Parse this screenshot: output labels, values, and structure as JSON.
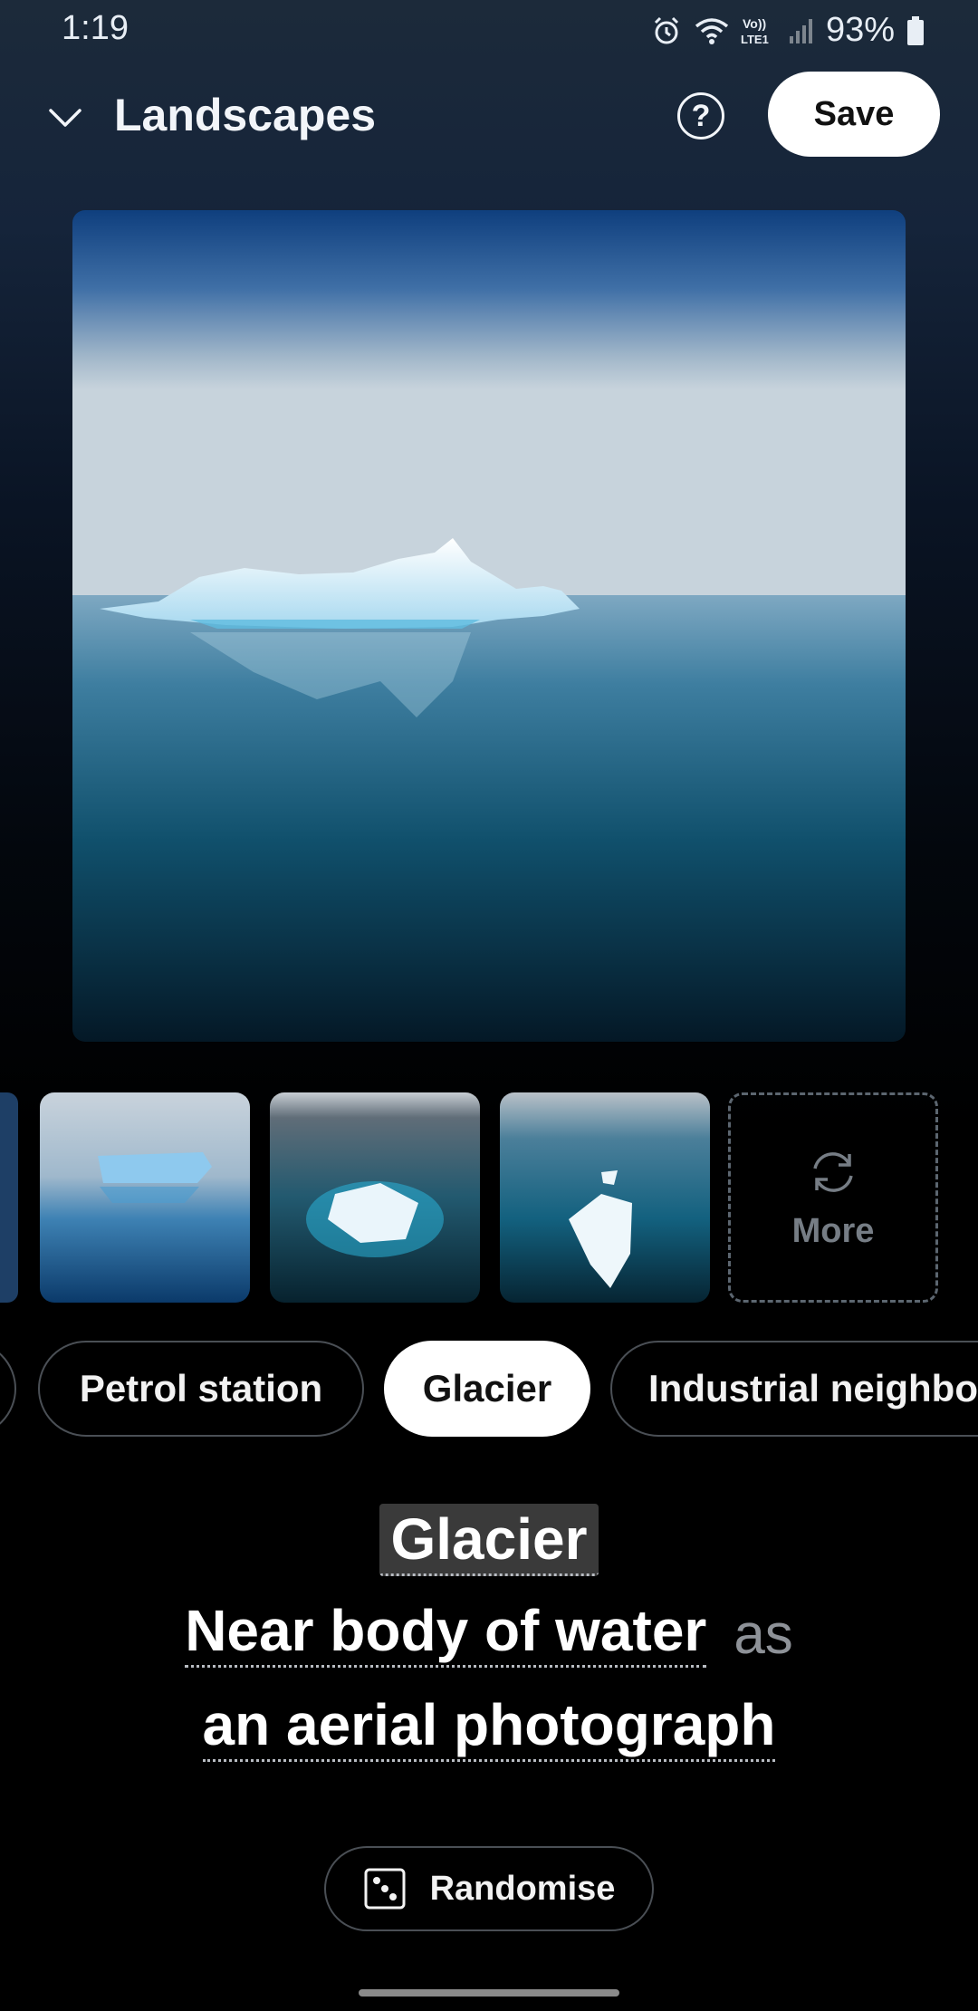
{
  "status_bar": {
    "time": "1:19",
    "battery": "93%",
    "network": "Vo)) LTE1",
    "icons": [
      "alarm-icon",
      "wifi-icon",
      "volte-icon",
      "signal-icon",
      "battery-icon"
    ]
  },
  "header": {
    "title": "Landscapes",
    "help_label": "?",
    "save_label": "Save",
    "icons": [
      "chevron-down-icon",
      "help-icon"
    ]
  },
  "thumbnails": {
    "more_label": "More",
    "more_icon": "refresh-icon"
  },
  "chips": [
    {
      "label": "Petrol station",
      "selected": false
    },
    {
      "label": "Glacier",
      "selected": true
    },
    {
      "label": "Industrial neighbo",
      "selected": false
    }
  ],
  "prompt": {
    "subject": "Glacier",
    "setting": "Near body of water",
    "connector": "as",
    "style": "an aerial photograph"
  },
  "randomise": {
    "label": "Randomise",
    "icon": "dice-icon"
  },
  "colors": {
    "accent_button": "#ffffff",
    "chip_border": "#4a4f55",
    "connector_text": "#8e9298"
  }
}
